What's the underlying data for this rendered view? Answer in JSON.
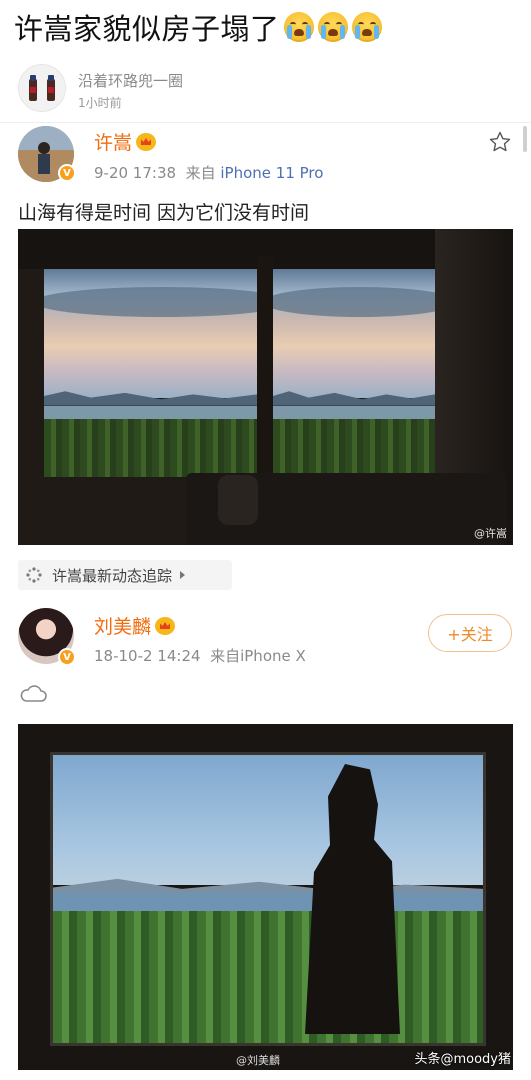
{
  "headline": {
    "title": "许嵩家貌似房子塌了",
    "emoji_icons": [
      "crying-face-icon",
      "crying-face-icon",
      "crying-face-icon"
    ]
  },
  "top_user": {
    "name": "沿着环路兜一圈",
    "time": "1小时前"
  },
  "post1": {
    "author": "许嵩",
    "date": "9-20 17:38",
    "source_prefix": "来自",
    "source_device": "iPhone 11 Pro",
    "text": "山海有得是时间 因为它们没有时间",
    "watermark": "@许嵩"
  },
  "tracker": {
    "label": "许嵩最新动态追踪"
  },
  "post2": {
    "author": "刘美麟",
    "date": "18-10-2 14:24",
    "source": "来自iPhone X",
    "follow_label": "+关注",
    "watermark": "@刘美麟"
  },
  "attribution": "头条@moody猪",
  "colors": {
    "author_name": "#f26d10",
    "source_link": "#4f6fb4",
    "follow_border": "#f0c18e"
  }
}
